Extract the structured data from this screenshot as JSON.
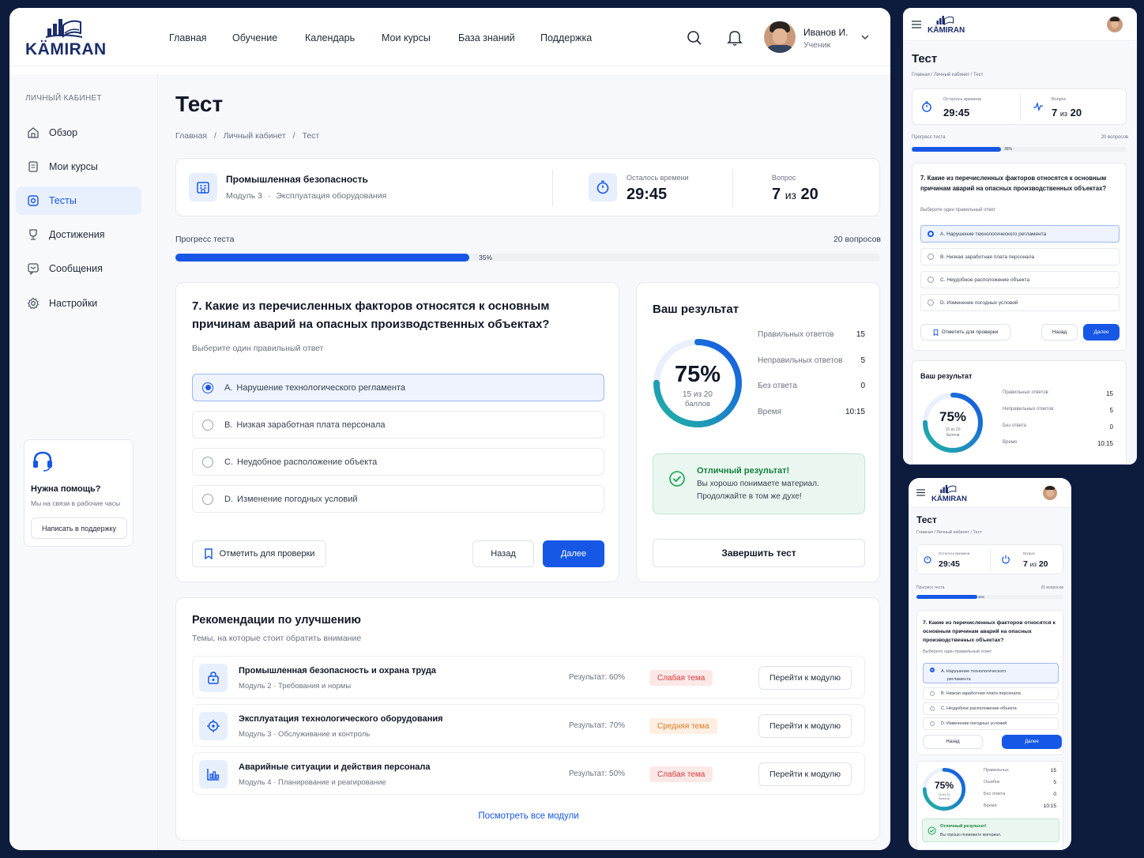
{
  "brand": {
    "name": "KÄMIRAN"
  },
  "nav": [
    "Главная",
    "Обучение",
    "Календарь",
    "Мои курсы",
    "База знаний",
    "Поддержка"
  ],
  "user": {
    "name": "Иванов И.",
    "role": "Ученик"
  },
  "sidebar": {
    "section": "ЛИЧНЫЙ КАБИНЕТ",
    "items": [
      {
        "label": "Обзор",
        "icon": "home-icon"
      },
      {
        "label": "Мои курсы",
        "icon": "book-icon"
      },
      {
        "label": "Тесты",
        "icon": "target-icon"
      },
      {
        "label": "Достижения",
        "icon": "trophy-icon"
      },
      {
        "label": "Сообщения",
        "icon": "message-icon"
      },
      {
        "label": "Настройки",
        "icon": "gear-icon"
      }
    ],
    "help": {
      "title": "Нужна помощь?",
      "text": "Мы на связи в рабочие часы",
      "button": "Написать в поддержку"
    }
  },
  "page": {
    "title": "Тест",
    "breadcrumb": [
      "Главная",
      "Личный кабинет",
      "Тест"
    ],
    "breadcrumb_sep": "/"
  },
  "course": {
    "title": "Промышленная безопасность",
    "module": "Модуль 3",
    "sep": "·",
    "topic": "Эксплуатация оборудования"
  },
  "timer": {
    "label": "Осталось времени",
    "value": "29:45"
  },
  "question_counter": {
    "label": "Вопрос",
    "current": "7",
    "of": "из",
    "total": "20"
  },
  "progress": {
    "label": "Прогресс теста",
    "percent_label": "35%",
    "value": 0.35,
    "total_label": "20 вопросов"
  },
  "question": {
    "number_text": "7. Какие из перечисленных факторов относятся к основным причинам аварий на опасных производственных объектах?",
    "hint": "Выберите один правильный ответ",
    "options": [
      {
        "letter": "A.",
        "text": "Нарушение технологического регламента",
        "selected": true
      },
      {
        "letter": "B.",
        "text": "Низкая заработная плата персонала",
        "selected": false
      },
      {
        "letter": "C.",
        "text": "Неудобное расположение объекта",
        "selected": false
      },
      {
        "letter": "D.",
        "text": "Изменение погодных условий",
        "selected": false
      }
    ],
    "mark_label": "Отметить для проверки",
    "back_label": "Назад",
    "next_label": "Далее"
  },
  "result": {
    "title": "Ваш результат",
    "percent": "75%",
    "value": 0.75,
    "sub1": "15 из 20",
    "sub2": "баллов",
    "stats": [
      {
        "label": "Правильных ответов",
        "value": "15"
      },
      {
        "label": "Неправильных ответов",
        "value": "5"
      },
      {
        "label": "Без ответа",
        "value": "0"
      },
      {
        "label": "Время",
        "value": "10:15"
      }
    ],
    "success_title": "Отличный результат!",
    "success_line1": "Вы хорошо понимаете материал.",
    "success_line2": "Продолжайте в том же духе!",
    "finish_label": "Завершить тест"
  },
  "recommendations": {
    "title": "Рекомендации по улучшению",
    "subtitle": "Темы, на которые стоит обратить внимание",
    "items": [
      {
        "title": "Промышленная безопасность и охрана труда",
        "meta": "Модуль 2 · Требования и нормы",
        "result": "Результат: 60%",
        "badge": "Слабая тема",
        "badge_type": "weak",
        "button": "Перейти к модулю",
        "icon": "lock-icon"
      },
      {
        "title": "Эксплуатация технологического оборудования",
        "meta": "Модуль 3 · Обслуживание и контроль",
        "result": "Результат: 70%",
        "badge": "Средняя тема",
        "badge_type": "medium",
        "button": "Перейти к модулю",
        "icon": "gear-target-icon"
      },
      {
        "title": "Аварийные ситуации и действия персонала",
        "meta": "Модуль 4 · Планирование и реагирование",
        "result": "Результат: 50%",
        "badge": "Слабая тема",
        "badge_type": "weak",
        "button": "Перейти к модулю",
        "icon": "chart-icon"
      }
    ],
    "view_all": "Посмотреть все модули"
  },
  "mobile": {
    "stats_short": [
      {
        "label": "Правильных",
        "value": "15"
      },
      {
        "label": "Ошибок",
        "value": "5"
      },
      {
        "label": "Без ответа",
        "value": "0"
      },
      {
        "label": "Время",
        "value": "10:15"
      }
    ],
    "option_a_line1": "A. Нарушение технологического",
    "option_a_line2": "регламента"
  },
  "colors": {
    "primary": "#1657e6",
    "success": "#16a34a",
    "weak": "#d93a3a",
    "medium": "#d9781f",
    "background": "#0d1b3d"
  }
}
